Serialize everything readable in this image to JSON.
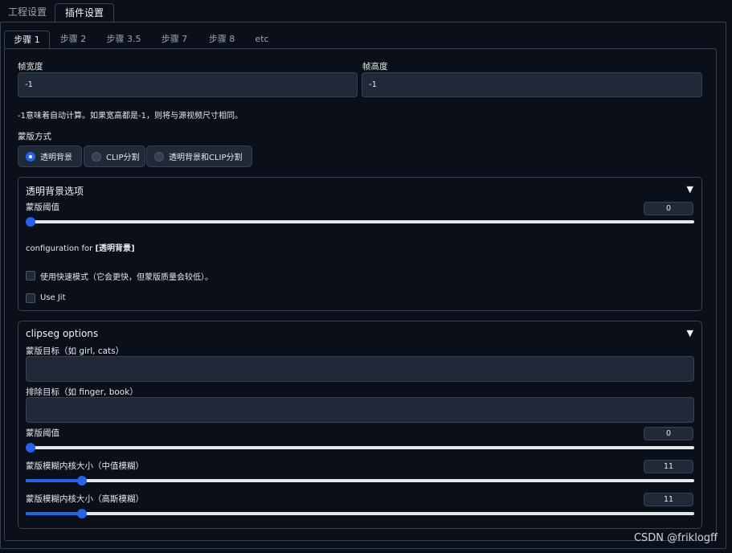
{
  "top_tabs": [
    "工程设置",
    "插件设置"
  ],
  "sub_tabs": [
    "步骤 1",
    "步骤 2",
    "步骤 3.5",
    "步骤 7",
    "步骤 8",
    "etc"
  ],
  "frame_width": {
    "label": "帧宽度",
    "value": "-1"
  },
  "frame_height": {
    "label": "帧高度",
    "value": "-1"
  },
  "hint": "-1意味着自动计算。如果宽高都是-1，则将与源视频尺寸相同。",
  "mask_mode": {
    "label": "蒙版方式",
    "options": [
      "透明背景",
      "CLIP分割",
      "透明背景和CLIP分割"
    ],
    "selected": "透明背景"
  },
  "transparent_bg_group": {
    "title": "透明背景选项",
    "toggle_icon": "triangle-down-icon",
    "threshold_label": "蒙版阈值",
    "threshold_value": "0",
    "threshold_fraction": 0,
    "config_prefix": "configuration for ",
    "config_name": "[透明背景]",
    "fast_mode_label": "使用快速模式（它会更快，但蒙版质量会较低）。",
    "fast_mode_checked": false,
    "use_jit_label": "Use Jit",
    "use_jit_checked": false
  },
  "clipseg_group": {
    "title": "clipseg options",
    "toggle_icon": "triangle-down-icon",
    "target_label": "蒙版目标（如 girl, cats）",
    "target_value": "",
    "exclude_label": "排除目标（如 finger, book）",
    "exclude_value": "",
    "threshold_label": "蒙版阈值",
    "threshold_value": "0",
    "threshold_fraction": 0,
    "median_label": "蒙版模糊内核大小（中值模糊）",
    "median_value": "11",
    "median_fraction": 0.078,
    "gauss_label": "蒙版模糊内核大小（高斯模糊）",
    "gauss_value": "11",
    "gauss_fraction": 0.078
  },
  "watermark": "CSDN @friklogff",
  "colors": {
    "accent": "#2563eb",
    "background": "#0b0f19",
    "input": "#1f2937",
    "border": "#374151"
  }
}
